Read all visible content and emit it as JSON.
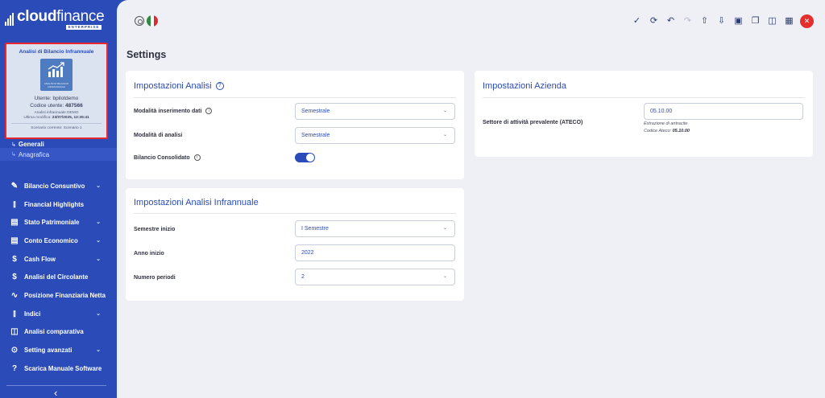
{
  "brand": {
    "name_bold": "cloud",
    "name_light": "finance",
    "edition": "ENTERPRISE"
  },
  "project": {
    "title": "Analisi di Bilancio Infrannuale",
    "thumb_caption": "ANALISI DI BILANCIO INFRANNUALE",
    "user_label": "Utente: bpilotdemo",
    "code_label": "Codice utente:",
    "code_value": "487566",
    "analysis_name": "Analisi infrannuale DEMO",
    "last_mod_label": "Ultima modifica:",
    "last_mod_value": "23/07/2025, 12:35:41",
    "scenario": "Scenario corrente: Scenario 1"
  },
  "subnav": {
    "items": [
      {
        "label": "Generali"
      },
      {
        "label": "Anagrafica"
      }
    ]
  },
  "nav": {
    "items": [
      {
        "label": "Bilancio Consuntivo",
        "icon": "edit-icon",
        "chevron": "⌄"
      },
      {
        "label": "Financial Highlights",
        "icon": "bar-chart-icon",
        "chevron": ""
      },
      {
        "label": "Stato Patrimoniale",
        "icon": "document-icon",
        "chevron": "⌄"
      },
      {
        "label": "Conto Economico",
        "icon": "document-icon",
        "chevron": "⌄"
      },
      {
        "label": "Cash Flow",
        "icon": "dollar-icon",
        "chevron": "⌄"
      },
      {
        "label": "Analisi del Circolante",
        "icon": "dollar-icon",
        "chevron": ""
      },
      {
        "label": "Posizione Finanziaria Netta",
        "icon": "pulse-icon",
        "chevron": ""
      },
      {
        "label": "Indici",
        "icon": "bar-chart-icon",
        "chevron": "⌄"
      },
      {
        "label": "Analisi comparativa",
        "icon": "columns-icon",
        "chevron": ""
      },
      {
        "label": "Setting avanzati",
        "icon": "toggle-icon",
        "chevron": "⌄"
      },
      {
        "label": "Scarica Manuale Software",
        "icon": "help-circle-icon",
        "chevron": ""
      }
    ],
    "collapse_glyph": "‹"
  },
  "toolbar": {
    "icons": [
      {
        "name": "check-icon",
        "glyph": "✓",
        "enabled": true
      },
      {
        "name": "refresh-icon",
        "glyph": "⟳",
        "enabled": true
      },
      {
        "name": "undo-icon",
        "glyph": "↶",
        "enabled": true
      },
      {
        "name": "redo-icon",
        "glyph": "↷",
        "enabled": false
      },
      {
        "name": "upload-icon",
        "glyph": "⇧",
        "enabled": true
      },
      {
        "name": "download-icon",
        "glyph": "⇩",
        "enabled": true
      },
      {
        "name": "save-icon",
        "glyph": "▣",
        "enabled": true
      },
      {
        "name": "copy-icon",
        "glyph": "❐",
        "enabled": true
      },
      {
        "name": "split-view-icon",
        "glyph": "◫",
        "enabled": true
      },
      {
        "name": "grid-icon",
        "glyph": "▦",
        "enabled": true
      }
    ],
    "close_glyph": "✕"
  },
  "page": {
    "title": "Settings"
  },
  "analisi": {
    "title": "Impostazioni Analisi",
    "q_glyph": "?",
    "mode_label": "Modalità inserimento dati",
    "mode_value": "Semestrale",
    "analysis_mode_label": "Modalità di analisi",
    "analysis_mode_value": "Semestrale",
    "consolidated_label": "Bilancio Consolidato",
    "consolidated_on": true
  },
  "infrannuale": {
    "title": "Impostazioni Analisi Infrannuale",
    "start_sem_label": "Semestre inizio",
    "start_sem_value": "I Semestre",
    "start_year_label": "Anno inizio",
    "start_year_value": "2022",
    "periods_label": "Numero periodi",
    "periods_value": "2"
  },
  "azienda": {
    "title": "Impostazioni Azienda",
    "ateco_label": "Settore di attività prevalente (ATECO)",
    "ateco_value": "05.10.00",
    "ateco_desc": "Estrazione di antracite",
    "ateco_code_label": "Codice Ateco:",
    "ateco_code_value": "05.10.00"
  },
  "colors": {
    "brand": "#2a4bb8",
    "danger": "#e52f2f",
    "background": "#eef0f5"
  }
}
